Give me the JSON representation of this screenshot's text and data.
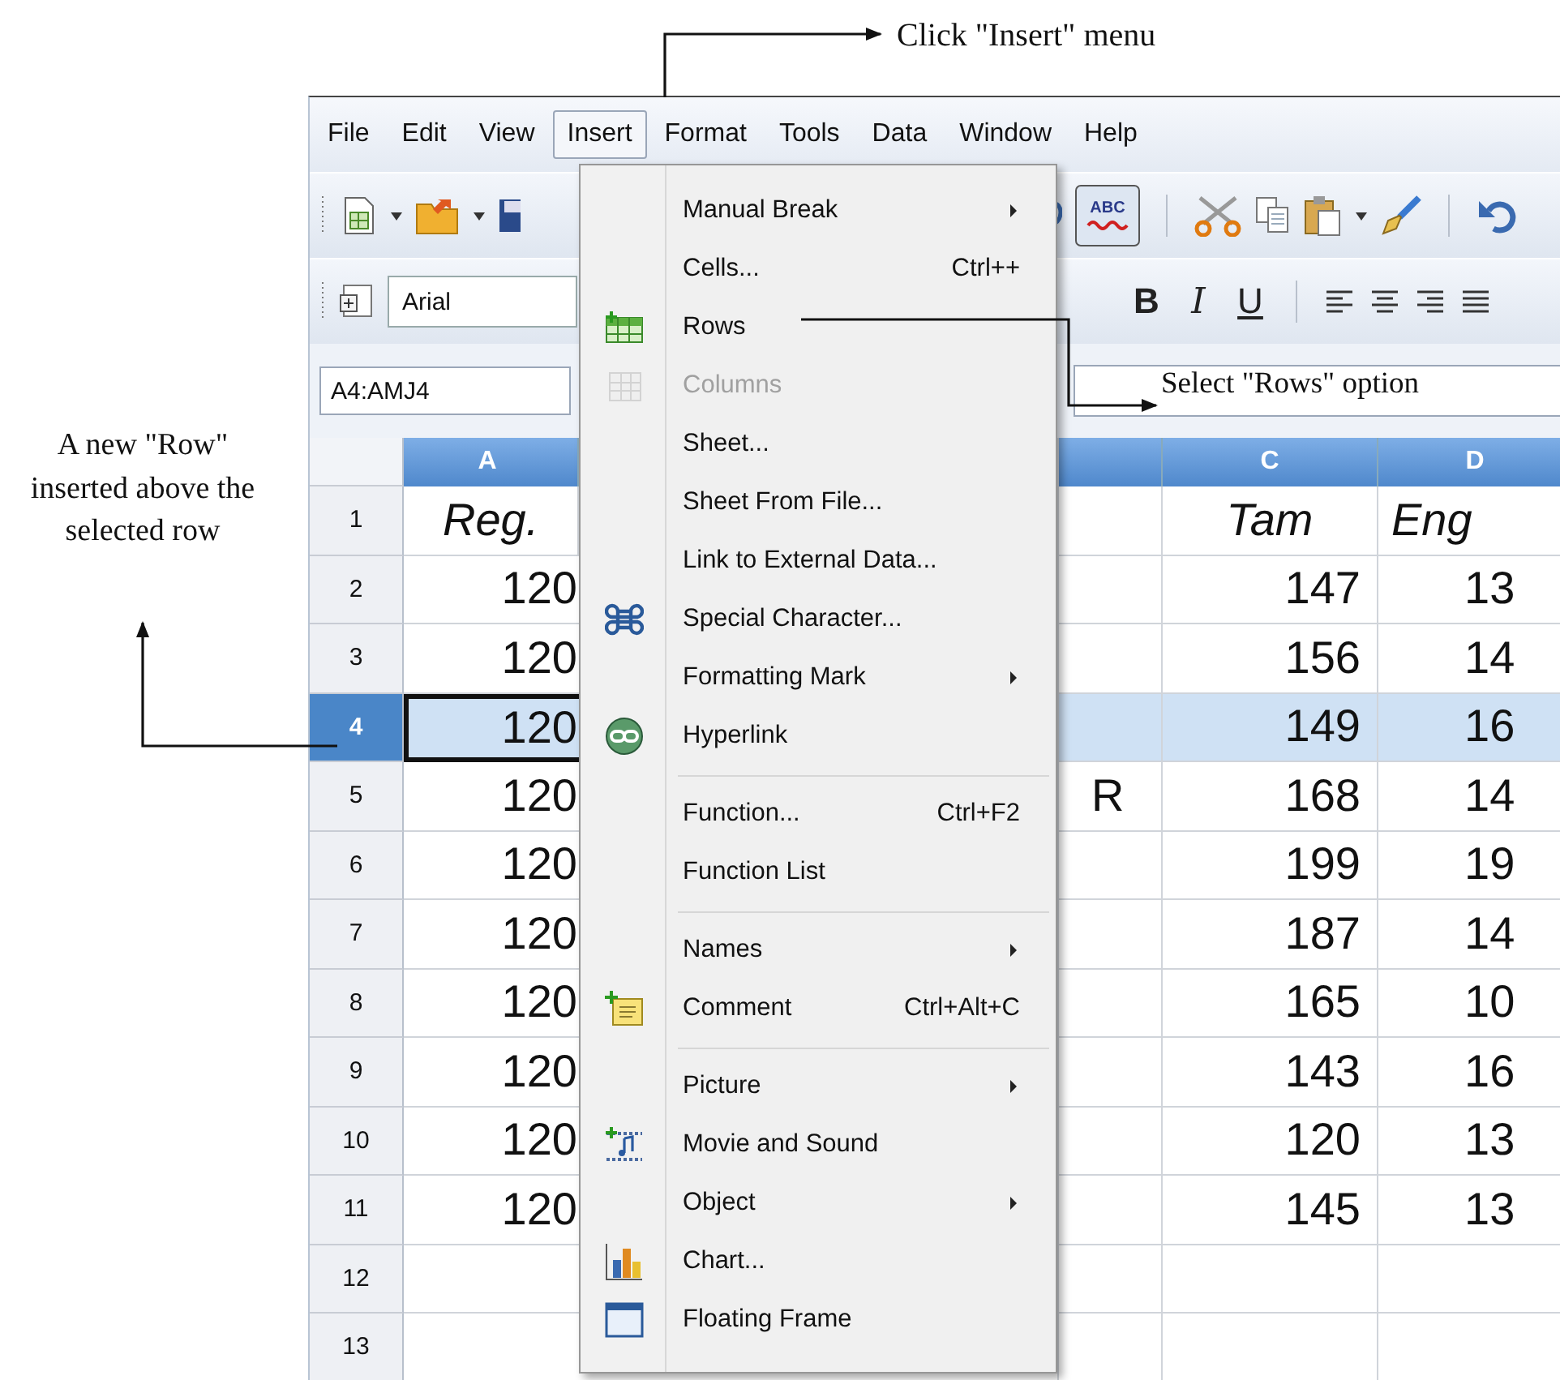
{
  "annotations": [
    {
      "text": "Click \"Insert\" menu"
    },
    {
      "text": "Select \"Rows\" option"
    },
    {
      "text": "A new \"Row\" inserted above the selected row"
    }
  ],
  "menubar": [
    {
      "label": "File",
      "selected": false
    },
    {
      "label": "Edit",
      "selected": false
    },
    {
      "label": "View",
      "selected": false
    },
    {
      "label": "Insert",
      "selected": true
    },
    {
      "label": "Format",
      "selected": false
    },
    {
      "label": "Tools",
      "selected": false
    },
    {
      "label": "Data",
      "selected": false
    },
    {
      "label": "Window",
      "selected": false
    },
    {
      "label": "Help",
      "selected": false
    }
  ],
  "standard_toolbar": {
    "spellcheck": "ABC"
  },
  "formatting_toolbar": {
    "font_name": "Arial",
    "buttons": [
      "B",
      "I",
      "U"
    ]
  },
  "name_box": "A4:AMJ4",
  "sheet": {
    "columns": [
      "A",
      null,
      "C",
      "D"
    ],
    "rows": [
      {
        "number": "1",
        "kind": "heading",
        "selected": false,
        "cells": [
          "Reg.",
          null,
          "Tam",
          "Eng"
        ]
      },
      {
        "number": "2",
        "kind": "data",
        "selected": false,
        "cells": [
          "120",
          null,
          "147",
          "13"
        ]
      },
      {
        "number": "3",
        "kind": "data",
        "selected": false,
        "cells": [
          "120",
          null,
          "156",
          "14"
        ]
      },
      {
        "number": "4",
        "kind": "data",
        "selected": true,
        "cells": [
          "120",
          null,
          "149",
          "16"
        ]
      },
      {
        "number": "5",
        "kind": "data",
        "selected": false,
        "cells": [
          "120",
          "R",
          "168",
          "14"
        ]
      },
      {
        "number": "6",
        "kind": "data",
        "selected": false,
        "cells": [
          "120",
          null,
          "199",
          "19"
        ]
      },
      {
        "number": "7",
        "kind": "data",
        "selected": false,
        "cells": [
          "120",
          null,
          "187",
          "14"
        ]
      },
      {
        "number": "8",
        "kind": "data",
        "selected": false,
        "cells": [
          "120",
          null,
          "165",
          "10"
        ]
      },
      {
        "number": "9",
        "kind": "data",
        "selected": false,
        "cells": [
          "120",
          null,
          "143",
          "16"
        ]
      },
      {
        "number": "10",
        "kind": "data",
        "selected": false,
        "cells": [
          "120",
          null,
          "120",
          "13"
        ]
      },
      {
        "number": "11",
        "kind": "data",
        "selected": false,
        "cells": [
          "120",
          null,
          "145",
          "13"
        ]
      },
      {
        "number": "12",
        "kind": "data",
        "selected": false,
        "cells": [
          null,
          null,
          null,
          null
        ]
      },
      {
        "number": "13",
        "kind": "data",
        "selected": false,
        "cells": [
          null,
          null,
          null,
          null
        ]
      }
    ]
  },
  "insert_menu": {
    "items": [
      {
        "kind": "item",
        "label": "Manual Break",
        "submenu": true,
        "disabled": false
      },
      {
        "kind": "item",
        "label": "Cells...",
        "shortcut": "Ctrl++",
        "submenu": false,
        "disabled": false
      },
      {
        "kind": "item",
        "label": "Rows",
        "submenu": false,
        "disabled": false
      },
      {
        "kind": "item",
        "label": "Columns",
        "submenu": false,
        "disabled": true
      },
      {
        "kind": "item",
        "label": "Sheet...",
        "submenu": false,
        "disabled": false
      },
      {
        "kind": "item",
        "label": "Sheet From File...",
        "submenu": false,
        "disabled": false
      },
      {
        "kind": "item",
        "label": "Link to External Data...",
        "submenu": false,
        "disabled": false
      },
      {
        "kind": "item",
        "label": "Special Character...",
        "submenu": false,
        "disabled": false
      },
      {
        "kind": "item",
        "label": "Formatting Mark",
        "submenu": true,
        "disabled": false
      },
      {
        "kind": "item",
        "label": "Hyperlink",
        "submenu": false,
        "disabled": false
      },
      {
        "kind": "separator"
      },
      {
        "kind": "item",
        "label": "Function...",
        "shortcut": "Ctrl+F2",
        "submenu": false,
        "disabled": false
      },
      {
        "kind": "item",
        "label": "Function List",
        "submenu": false,
        "disabled": false
      },
      {
        "kind": "separator"
      },
      {
        "kind": "item",
        "label": "Names",
        "submenu": true,
        "disabled": false
      },
      {
        "kind": "item",
        "label": "Comment",
        "shortcut": "Ctrl+Alt+C",
        "submenu": false,
        "disabled": false
      },
      {
        "kind": "separator"
      },
      {
        "kind": "item",
        "label": "Picture",
        "submenu": true,
        "disabled": false
      },
      {
        "kind": "item",
        "label": "Movie and Sound",
        "submenu": false,
        "disabled": false
      },
      {
        "kind": "item",
        "label": "Object",
        "submenu": true,
        "disabled": false
      },
      {
        "kind": "item",
        "label": "Chart...",
        "submenu": false,
        "disabled": false
      },
      {
        "kind": "item",
        "label": "Floating Frame",
        "submenu": false,
        "disabled": false
      }
    ]
  }
}
